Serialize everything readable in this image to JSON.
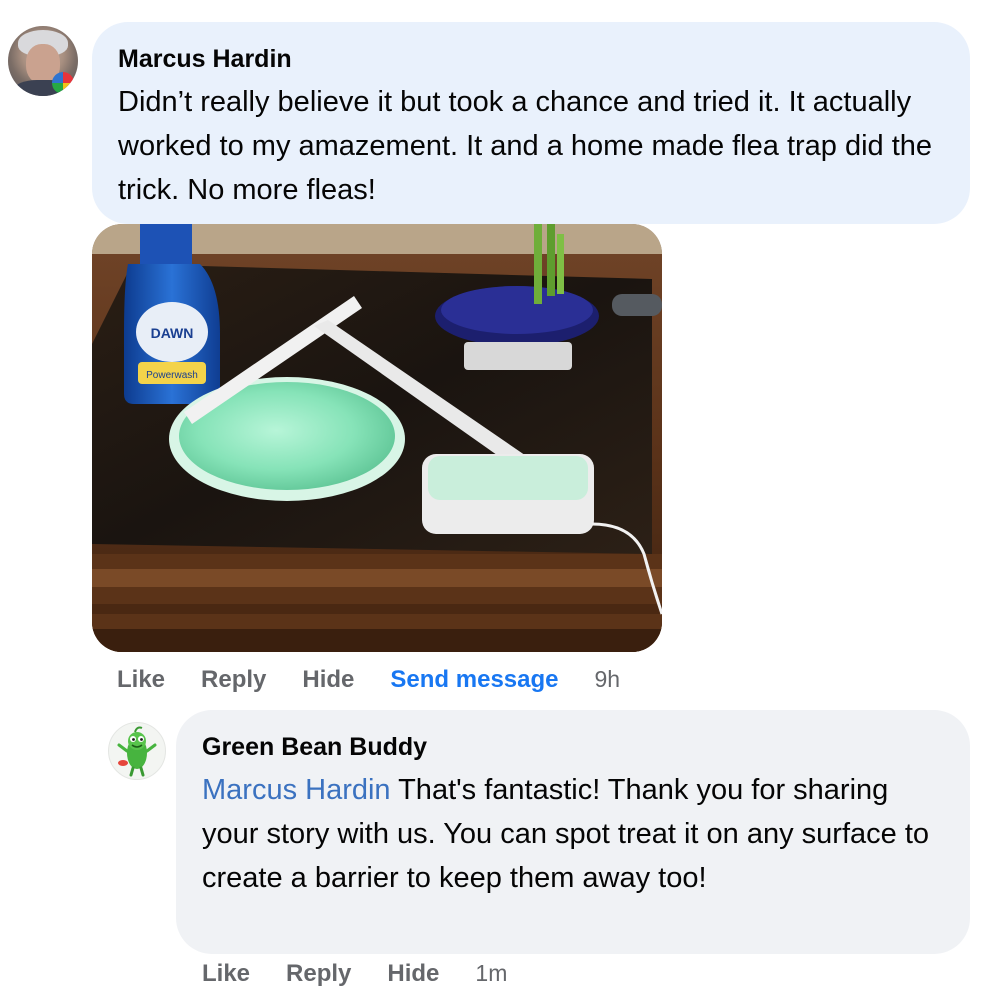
{
  "comment": {
    "author": "Marcus Hardin",
    "text": "Didn’t really believe it but took a chance and tried it. It actually worked to my amazement. It and a home made flea trap did the trick. No more fleas!",
    "actions": {
      "like": "Like",
      "reply": "Reply",
      "hide": "Hide",
      "send_message": "Send message",
      "time": "9h"
    },
    "photo": {
      "bottle_label": "DAWN",
      "bottle_sublabel": "Powerwash"
    }
  },
  "reply": {
    "author": "Green Bean Buddy",
    "mention": "Marcus Hardin",
    "text": " That's fantastic! Thank you for sharing your story with us. You can spot treat it on any surface to create a barrier to keep them away too!",
    "actions": {
      "like": "Like",
      "reply": "Reply",
      "hide": "Hide",
      "time": "1m"
    }
  },
  "colors": {
    "link_blue": "#1877f2",
    "mention_blue": "#3b72c0",
    "action_gray": "#65676b",
    "bubble_blue": "#e9f1fc",
    "bubble_gray": "#f0f2f5"
  },
  "icons": {
    "marcus_avatar": "profile-photo-avatar",
    "buddy_avatar": "green-bean-mascot-avatar"
  }
}
